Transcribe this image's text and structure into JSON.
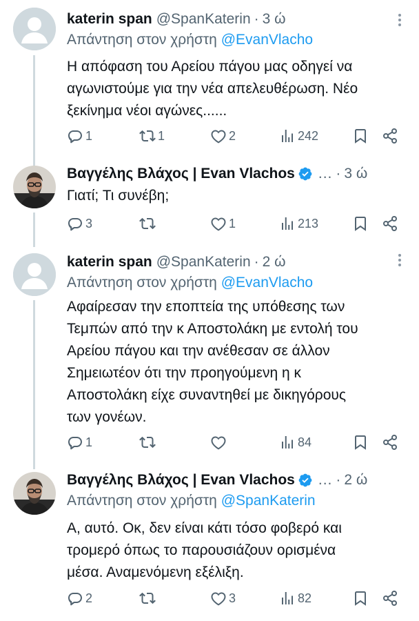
{
  "tweets": [
    {
      "name": "katerin span",
      "handle": "@SpanKaterin",
      "dot": "·",
      "time": "3 ώ",
      "reply_prefix": "Απάντηση στον χρήστη",
      "reply_to": "@EvanVlacho",
      "text": "Η απόφαση του Αρείου πάγου μας οδηγεί  να\nαγωνιστούμε για την νέα απελευθέρωση. Νέο\nξεκίνημα νέοι αγώνες......",
      "counts": {
        "replies": "1",
        "retweets": "1",
        "likes": "2",
        "views": "242"
      }
    },
    {
      "name": "Βαγγέλης Βλάχος | Evan Vlachos",
      "ellipsis": "...",
      "dot": "·",
      "time": "3 ώ",
      "text": "Γιατί; Τι συνέβη;",
      "counts": {
        "replies": "3",
        "retweets": "",
        "likes": "1",
        "views": "213"
      }
    },
    {
      "name": "katerin span",
      "handle": "@SpanKaterin",
      "dot": "·",
      "time": "2 ώ",
      "reply_prefix": "Απάντηση στον χρήστη",
      "reply_to": "@EvanVlacho",
      "text": "Αφαίρεσαν την εποπτεία της υπόθεσης των\nΤεμπών από την κ Αποστολάκη  με εντολή του\nΑρείου πάγου και την ανέθεσαν σε άλλον\n Σημειωτέον ότι την προηγούμενη η κ\nΑποστολάκη είχε συναντηθεί με δικηγόρους\nτων γονέων.",
      "counts": {
        "replies": "1",
        "retweets": "",
        "likes": "",
        "views": "84"
      }
    },
    {
      "name": "Βαγγέλης Βλάχος | Evan Vlachos",
      "ellipsis": "...",
      "dot": "·",
      "time": "2 ώ",
      "reply_prefix": "Απάντηση στον χρήστη",
      "reply_to": "@SpanKaterin",
      "text": "Α, αυτό. Οκ, δεν είναι κάτι τόσο φοβερό και\nτρομερό όπως το παρουσιάζουν ορισμένα\nμέσα. Αναμενόμενη εξέλιξη.",
      "counts": {
        "replies": "2",
        "retweets": "",
        "likes": "3",
        "views": "82"
      }
    }
  ],
  "icons": {
    "reply": "reply-icon",
    "retweet": "retweet-icon",
    "like": "heart-icon",
    "views": "views-icon",
    "bookmark": "bookmark-icon",
    "share": "share-icon",
    "verified": "verified-badge-icon",
    "more": "more-options-icon"
  },
  "colors": {
    "text": "#0f1419",
    "secondary": "#536471",
    "link": "#1d9bf0",
    "thread_line": "#cfd9de",
    "default_avatar": "#cfd9de"
  }
}
